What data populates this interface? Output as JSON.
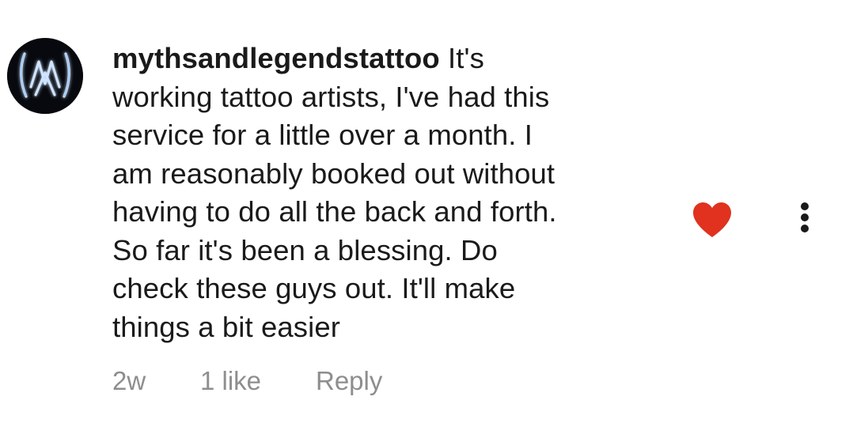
{
  "comment": {
    "username": "mythsandlegendstattoo",
    "text_lines": [
      "It's",
      "working tattoo artists, I've had this",
      "service for a little over a month. I",
      "am reasonably booked out without",
      "having to do all the back and forth.",
      "So far it's been a blessing. Do",
      "check these guys out. It'll make",
      "things a bit easier"
    ],
    "timestamp": "2w",
    "likes": "1 like",
    "reply_label": "Reply",
    "liked": true,
    "heart_color": "#e0321e",
    "avatar_icon": "mythsandlegends-logo",
    "more_icon": "vertical-ellipsis-icon"
  }
}
